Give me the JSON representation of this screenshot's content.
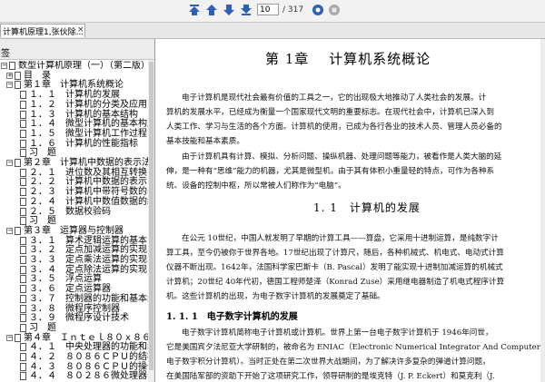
{
  "toolbar": {
    "page_current": "10",
    "page_total": "/ 317"
  },
  "tab": {
    "label": "计算机原理1,张伙除...",
    "close": "×"
  },
  "sidebar": {
    "title": "签",
    "tree": [
      {
        "label": "数型计算机原理（一）（第二版）",
        "toggle": "−",
        "bookmark": true
      },
      {
        "label": "目　录",
        "toggle": "+",
        "bookmark": true
      },
      {
        "label": "第１章　计算机系统概论",
        "toggle": "−",
        "bookmark": true
      },
      {
        "label": "１．１　计算机的发展",
        "toggle": "",
        "bookmark": true
      },
      {
        "label": "１．２　计算机的分类及应用",
        "toggle": "",
        "bookmark": true
      },
      {
        "label": "１．３　计算机的基本结构",
        "toggle": "",
        "bookmark": true
      },
      {
        "label": "１．４　微型计算机的基本构成",
        "toggle": "",
        "bookmark": true
      },
      {
        "label": "１．５　微型计算机工作过程",
        "toggle": "",
        "bookmark": true
      },
      {
        "label": "１．６　计算机的性能指标",
        "toggle": "",
        "bookmark": true
      },
      {
        "label": "习　题",
        "toggle": "",
        "bookmark": true
      },
      {
        "label": "第２章　计算机中数据的表示法",
        "toggle": "−",
        "bookmark": true
      },
      {
        "label": "２．１　进位数及其相互转换",
        "toggle": "",
        "bookmark": true
      },
      {
        "label": "２．２　计算机中数据的表示",
        "toggle": "",
        "bookmark": true
      },
      {
        "label": "２．３　计算机中带符号数的表示",
        "toggle": "",
        "bookmark": true
      },
      {
        "label": "２．４　计算机中数值数据的编码",
        "toggle": "",
        "bookmark": true
      },
      {
        "label": "２．５　数据校验码",
        "toggle": "",
        "bookmark": true
      },
      {
        "label": "习　题",
        "toggle": "",
        "bookmark": true
      },
      {
        "label": "第３章　运算器与控制器",
        "toggle": "−",
        "bookmark": true
      },
      {
        "label": "３．１　算术逻辑运算的基本电路",
        "toggle": "",
        "bookmark": true
      },
      {
        "label": "３．２　定点加减运算的实现",
        "toggle": "",
        "bookmark": true
      },
      {
        "label": "３．３　定点乘法运算的实现",
        "toggle": "",
        "bookmark": true
      },
      {
        "label": "３．４　定点除法运算的实现",
        "toggle": "",
        "bookmark": true
      },
      {
        "label": "３．５　浮点运算",
        "toggle": "",
        "bookmark": true
      },
      {
        "label": "３．６　定点运算器",
        "toggle": "",
        "bookmark": true
      },
      {
        "label": "３．７　控制器的功能和基本组成",
        "toggle": "",
        "bookmark": true
      },
      {
        "label": "３．８　微程序控制器",
        "toggle": "",
        "bookmark": true
      },
      {
        "label": "３．９　微程序设计技术",
        "toggle": "",
        "bookmark": true
      },
      {
        "label": "习　题",
        "toggle": "",
        "bookmark": true
      },
      {
        "label": "第４章　Ｉｎｔｅｌ８０ｘ８６微处理器",
        "toggle": "−",
        "bookmark": true
      },
      {
        "label": "４．１　中央处理器的功能和组成",
        "toggle": "",
        "bookmark": true
      },
      {
        "label": "４．２　８０８６ＣＰＵ的结构",
        "toggle": "",
        "bookmark": true
      },
      {
        "label": "４．３　８０８６ＣＰＵ的操作时序",
        "toggle": "",
        "bookmark": true
      },
      {
        "label": "４．４　８０２８６微处理器",
        "toggle": "",
        "bookmark": true
      }
    ]
  },
  "document": {
    "chapter_title": "第 1章　 计算机系统概论",
    "intro": [
      "电子计算机是现代社会最有价值的工具之一，它的出现极大地推动了人类社会的发展。计",
      "算机的发展水平，已经成为衡量一个国家现代文明的重要标志。在现代社会中，计算机已深入到",
      "人类工作、学习与生活的各个方面。计算机的使用，已成为各行各业的技术人员、管理人员必备的",
      "基本技能和基本素质。"
    ],
    "intro2": [
      "由于计算机具有计算、模拟、分析问题、操纵机器、处理问题等能力，被看作是人类大脑的延",
      "伸，是一种有“思维”能力的机器，尤其是微型机，由于其有体积小重量轻的特点，可作为各种系",
      "统、设备的控制中枢，所以常被人们称作为“电脑”。"
    ],
    "section_title": "1. 1　计算机的发展",
    "section_para": [
      "在公元 10世纪，中国人就发明了早期的计算工具——算盘，它采用十进制运算，是纯数字计",
      "算工具，至今仍被你于世界各地。17世纪出现了计算尺，随后，各种机械式、机电式、电动式计算",
      "仪器不断出现。1642年，法国科学家巴斯卡（B. Pascal）发明了能实现十进制加减运算的机械式",
      "计算机；20世纪 40年代初，德国工程师楚泽（Konrad Zuse）采用继电器制造了机电式程序计算",
      "机。这些计算机的出现，为电子数字计算机的发展奠定了基础。"
    ],
    "subsection_title": "1. 1. 1　电子数字计算机的发展",
    "subsection_para": [
      "电子数字计算机简称电子计算机或计算机。世界上第一台电子数字计算机于 1946年问世，",
      "它是美国宾夕法尼亚大学研制的，被命名为 ENIAC（Electronic Numerical Integrator And Computer",
      "电子数字积分计算机）。当时正处在第二次世界大战期间，为了解决许多复杂的弹道计算问题，",
      "在美国陆军部的资助下开始了这项研究工作，领导研制的是埃克特（J. P. Eckert）和莫克利（J."
    ]
  },
  "colors": {
    "toolbar_icon": "#2f5fb6",
    "toolbar_icon_disabled": "#a8a8a8"
  }
}
